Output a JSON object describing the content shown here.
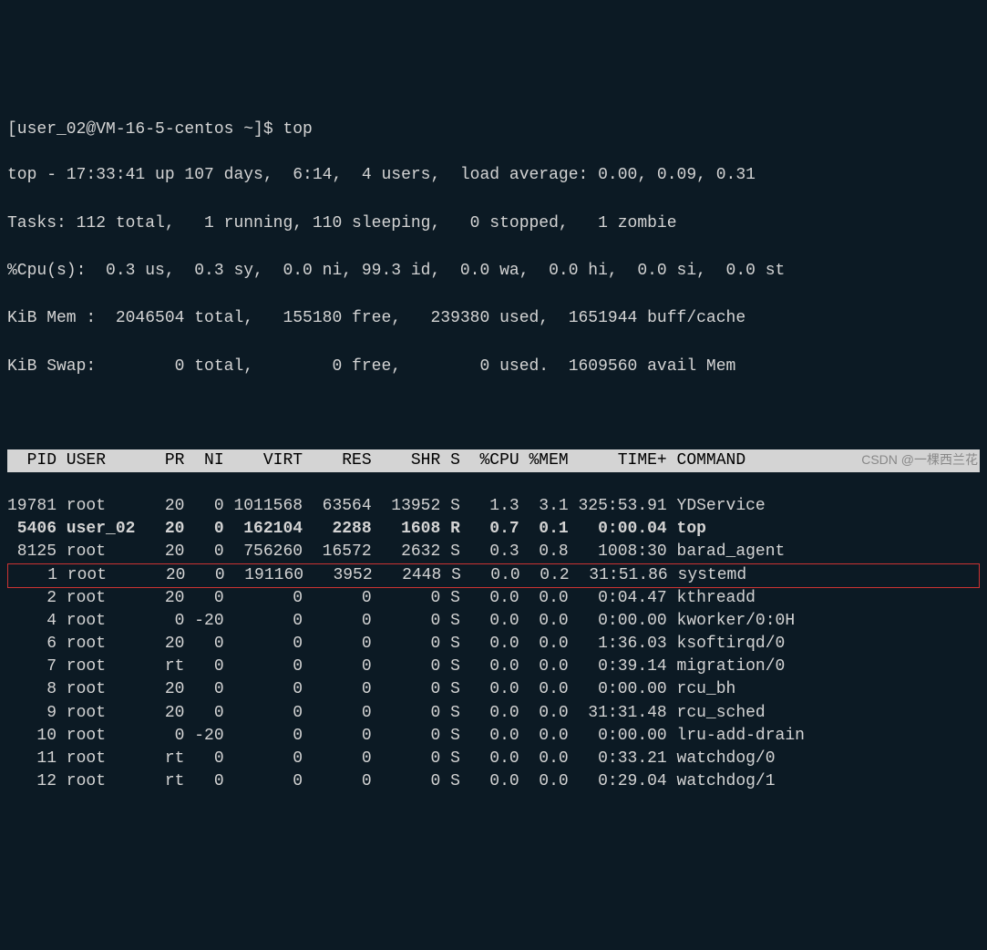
{
  "prompt": "[user_02@VM-16-5-centos ~]$ top",
  "summary": {
    "line1": "top - 17:33:41 up 107 days,  6:14,  4 users,  load average: 0.00, 0.09, 0.31",
    "line2": "Tasks: 112 total,   1 running, 110 sleeping,   0 stopped,   1 zombie",
    "line3": "%Cpu(s):  0.3 us,  0.3 sy,  0.0 ni, 99.3 id,  0.0 wa,  0.0 hi,  0.0 si,  0.0 st",
    "line4": "KiB Mem :  2046504 total,   155180 free,   239380 used,  1651944 buff/cache",
    "line5": "KiB Swap:        0 total,        0 free,        0 used.  1609560 avail Mem"
  },
  "columns": [
    "PID",
    "USER",
    "PR",
    "NI",
    "VIRT",
    "RES",
    "SHR",
    "S",
    "%CPU",
    "%MEM",
    "TIME+",
    "COMMAND"
  ],
  "processes": [
    {
      "pid": "19781",
      "user": "root",
      "pr": "20",
      "ni": "0",
      "virt": "1011568",
      "res": "63564",
      "shr": "13952",
      "s": "S",
      "cpu": "1.3",
      "mem": "3.1",
      "time": "325:53.91",
      "cmd": "YDService",
      "bold": false,
      "highlight": false
    },
    {
      "pid": "5406",
      "user": "user_02",
      "pr": "20",
      "ni": "0",
      "virt": "162104",
      "res": "2288",
      "shr": "1608",
      "s": "R",
      "cpu": "0.7",
      "mem": "0.1",
      "time": "0:00.04",
      "cmd": "top",
      "bold": true,
      "highlight": false
    },
    {
      "pid": "8125",
      "user": "root",
      "pr": "20",
      "ni": "0",
      "virt": "756260",
      "res": "16572",
      "shr": "2632",
      "s": "S",
      "cpu": "0.3",
      "mem": "0.8",
      "time": "1008:30",
      "cmd": "barad_agent",
      "bold": false,
      "highlight": false
    },
    {
      "pid": "1",
      "user": "root",
      "pr": "20",
      "ni": "0",
      "virt": "191160",
      "res": "3952",
      "shr": "2448",
      "s": "S",
      "cpu": "0.0",
      "mem": "0.2",
      "time": "31:51.86",
      "cmd": "systemd",
      "bold": false,
      "highlight": true
    },
    {
      "pid": "2",
      "user": "root",
      "pr": "20",
      "ni": "0",
      "virt": "0",
      "res": "0",
      "shr": "0",
      "s": "S",
      "cpu": "0.0",
      "mem": "0.0",
      "time": "0:04.47",
      "cmd": "kthreadd",
      "bold": false,
      "highlight": false
    },
    {
      "pid": "4",
      "user": "root",
      "pr": "0",
      "ni": "-20",
      "virt": "0",
      "res": "0",
      "shr": "0",
      "s": "S",
      "cpu": "0.0",
      "mem": "0.0",
      "time": "0:00.00",
      "cmd": "kworker/0:0H",
      "bold": false,
      "highlight": false
    },
    {
      "pid": "6",
      "user": "root",
      "pr": "20",
      "ni": "0",
      "virt": "0",
      "res": "0",
      "shr": "0",
      "s": "S",
      "cpu": "0.0",
      "mem": "0.0",
      "time": "1:36.03",
      "cmd": "ksoftirqd/0",
      "bold": false,
      "highlight": false
    },
    {
      "pid": "7",
      "user": "root",
      "pr": "rt",
      "ni": "0",
      "virt": "0",
      "res": "0",
      "shr": "0",
      "s": "S",
      "cpu": "0.0",
      "mem": "0.0",
      "time": "0:39.14",
      "cmd": "migration/0",
      "bold": false,
      "highlight": false
    },
    {
      "pid": "8",
      "user": "root",
      "pr": "20",
      "ni": "0",
      "virt": "0",
      "res": "0",
      "shr": "0",
      "s": "S",
      "cpu": "0.0",
      "mem": "0.0",
      "time": "0:00.00",
      "cmd": "rcu_bh",
      "bold": false,
      "highlight": false
    },
    {
      "pid": "9",
      "user": "root",
      "pr": "20",
      "ni": "0",
      "virt": "0",
      "res": "0",
      "shr": "0",
      "s": "S",
      "cpu": "0.0",
      "mem": "0.0",
      "time": "31:31.48",
      "cmd": "rcu_sched",
      "bold": false,
      "highlight": false
    },
    {
      "pid": "10",
      "user": "root",
      "pr": "0",
      "ni": "-20",
      "virt": "0",
      "res": "0",
      "shr": "0",
      "s": "S",
      "cpu": "0.0",
      "mem": "0.0",
      "time": "0:00.00",
      "cmd": "lru-add-drain",
      "bold": false,
      "highlight": false
    },
    {
      "pid": "11",
      "user": "root",
      "pr": "rt",
      "ni": "0",
      "virt": "0",
      "res": "0",
      "shr": "0",
      "s": "S",
      "cpu": "0.0",
      "mem": "0.0",
      "time": "0:33.21",
      "cmd": "watchdog/0",
      "bold": false,
      "highlight": false
    },
    {
      "pid": "12",
      "user": "root",
      "pr": "rt",
      "ni": "0",
      "virt": "0",
      "res": "0",
      "shr": "0",
      "s": "S",
      "cpu": "0.0",
      "mem": "0.0",
      "time": "0:29.04",
      "cmd": "watchdog/1",
      "bold": false,
      "highlight": false
    }
  ],
  "watermark": "CSDN @一棵西兰花"
}
